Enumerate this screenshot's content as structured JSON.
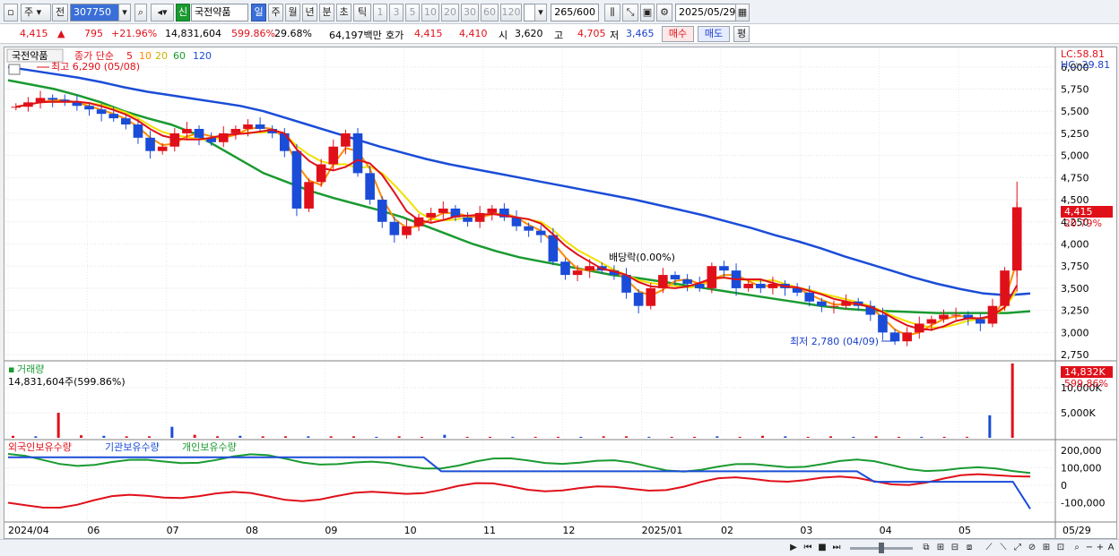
{
  "toolbar": {
    "period_week": "주",
    "period_prev": "전",
    "stock_code": "307750",
    "credit_badge": "신",
    "stock_name": "국전약품",
    "tabs": [
      "일",
      "주",
      "월",
      "년",
      "분",
      "초",
      "틱"
    ],
    "intervals": [
      "1",
      "3",
      "5",
      "10",
      "20",
      "30",
      "60",
      "120"
    ],
    "count": "265",
    "count_total": "/600",
    "date": "2025/05/29"
  },
  "quote": {
    "price": "4,415",
    "change_arrow": "▲",
    "change": "795",
    "change_pct": "+21.96%",
    "volume": "14,831,604",
    "volume_pct": "599.86%",
    "turnover_pct": "29.68%",
    "trade_value": "64,197백만",
    "hoga_label": "호가",
    "ask": "4,415",
    "bid": "4,410",
    "open_label": "시",
    "open": "3,620",
    "high_label": "고",
    "high": "4,705",
    "low_label": "저",
    "low": "3,465",
    "buy_button": "매수",
    "sell_button": "매도",
    "eval_button": "평"
  },
  "chart_data": [
    {
      "type": "candlestick",
      "title": "국전약품",
      "ma_label": "종가 단순",
      "ma_periods": [
        "5",
        "10",
        "20",
        "60",
        "120"
      ],
      "ma_colors": [
        "#e0101a",
        "#ff8c00",
        "#f0e000",
        "#1a9a30",
        "#1a4cd8"
      ],
      "lc_label": "LC:58.81",
      "hc_label": "HC:-29.81",
      "high_annotation": "최고 6,290 (05/08)",
      "low_annotation": "최저 2,780 (04/09)",
      "dividend_annotation": "배당락(0.00%)",
      "y_ticks": [
        "6,000",
        "5,750",
        "5,500",
        "5,250",
        "5,000",
        "4,750",
        "4,500",
        "4,250",
        "4,000",
        "3,750",
        "3,500",
        "3,250",
        "3,000",
        "2,750"
      ],
      "ylim": [
        2700,
        6200
      ],
      "last_price_label": "4,415",
      "last_change_label": "20.79%",
      "closes": [
        5550,
        5600,
        5650,
        5630,
        5600,
        5560,
        5520,
        5470,
        5420,
        5350,
        5200,
        5050,
        5100,
        5250,
        5300,
        5200,
        5150,
        5250,
        5300,
        5350,
        5300,
        5250,
        5050,
        4400,
        4700,
        4900,
        5100,
        5250,
        4800,
        4500,
        4250,
        4100,
        4200,
        4300,
        4350,
        4400,
        4300,
        4250,
        4350,
        4400,
        4300,
        4200,
        4150,
        4100,
        3800,
        3650,
        3700,
        3750,
        3700,
        3650,
        3450,
        3300,
        3500,
        3650,
        3600,
        3550,
        3500,
        3750,
        3700,
        3500,
        3550,
        3500,
        3550,
        3500,
        3450,
        3350,
        3300,
        3300,
        3350,
        3300,
        3200,
        3000,
        2900,
        3000,
        3100,
        3150,
        3200,
        3200,
        3150,
        3100,
        3300,
        3700,
        4415
      ],
      "ma120": [
        6000,
        5960,
        5920,
        5880,
        5830,
        5770,
        5720,
        5680,
        5640,
        5600,
        5560,
        5500,
        5420,
        5340,
        5260,
        5180,
        5100,
        5030,
        4960,
        4900,
        4850,
        4800,
        4750,
        4700,
        4650,
        4600,
        4550,
        4500,
        4440,
        4380,
        4320,
        4250,
        4180,
        4100,
        4030,
        3950,
        3860,
        3780,
        3700,
        3620,
        3550,
        3490,
        3440,
        3420,
        3440
      ],
      "ma60": [
        5850,
        5800,
        5750,
        5680,
        5600,
        5500,
        5420,
        5350,
        5250,
        5100,
        4950,
        4800,
        4700,
        4600,
        4520,
        4450,
        4380,
        4300,
        4200,
        4100,
        4000,
        3920,
        3850,
        3800,
        3750,
        3700,
        3650,
        3620,
        3580,
        3540,
        3500,
        3460,
        3420,
        3380,
        3340,
        3300,
        3270,
        3250,
        3240,
        3230,
        3220,
        3220,
        3220,
        3220,
        3240
      ],
      "volume_label": "거래량",
      "volume_value": "14,831,604주(599.86%)",
      "volume_last_label": "14,832K",
      "volume_last_pct": "599.86%",
      "volume_ticks": [
        "10,000K",
        "5,000K"
      ],
      "volume_ylim": [
        0,
        15000
      ],
      "volumes_k": [
        400,
        300,
        5000,
        500,
        400,
        300,
        300,
        2200,
        600,
        300,
        400,
        300,
        300,
        300,
        300,
        300,
        200,
        300,
        200,
        600,
        200,
        200,
        200,
        200,
        200,
        200,
        300,
        300,
        200,
        200,
        200,
        300,
        200,
        400,
        300,
        200,
        300,
        200,
        300,
        200,
        200,
        200,
        200,
        4500,
        14832
      ],
      "holdings_labels": [
        "외국인보유수량",
        "기관보유수량",
        "개인보유수량"
      ],
      "holdings_colors": [
        "#e0101a",
        "#1a4cd8",
        "#1a9a30"
      ],
      "holdings_ticks": [
        "200,000",
        "100,000",
        "0",
        "-100,000"
      ],
      "x_labels": [
        "2024/04",
        "06",
        "07",
        "08",
        "09",
        "10",
        "11",
        "12",
        "2025/01",
        "02",
        "03",
        "04",
        "05"
      ],
      "x_last_label": "05/29"
    }
  ]
}
